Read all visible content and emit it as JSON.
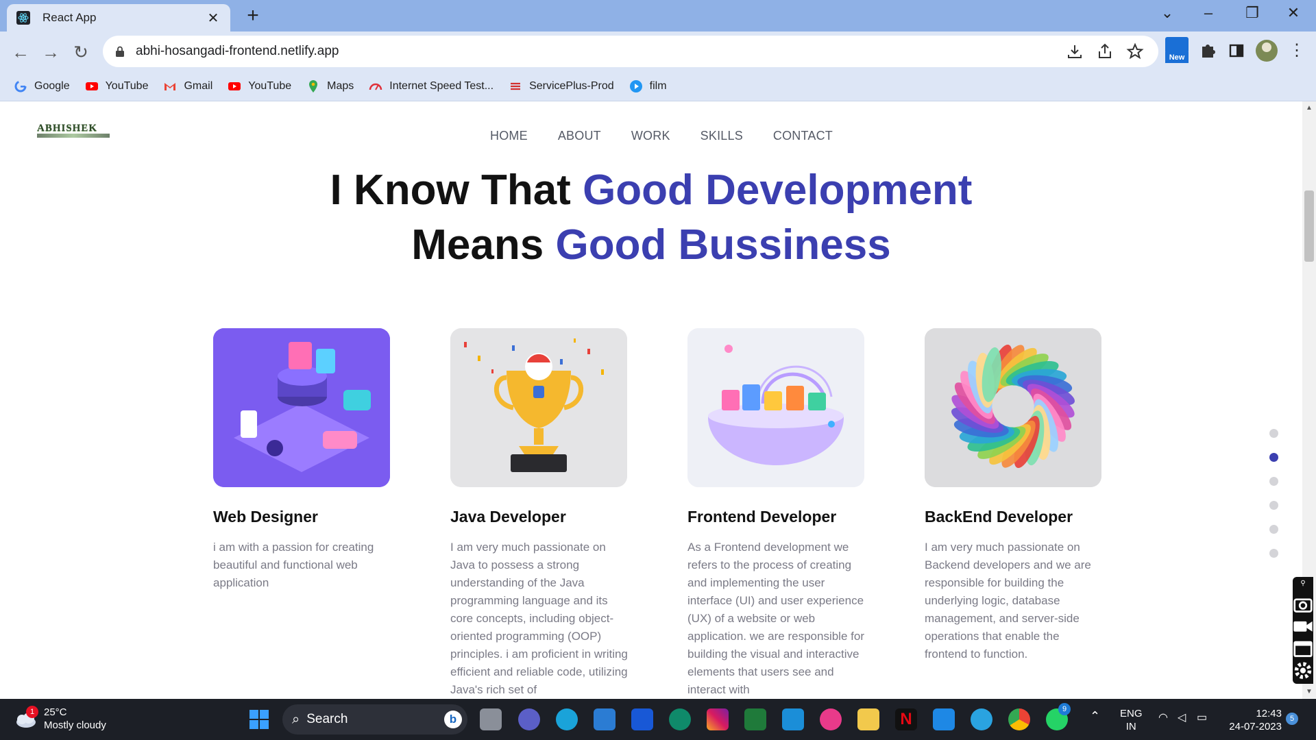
{
  "browser": {
    "tab_title": "React App",
    "url": "abhi-hosangadi-frontend.netlify.app",
    "new_badge": "New",
    "bookmarks": [
      {
        "label": "Google",
        "icon": "google-icon"
      },
      {
        "label": "YouTube",
        "icon": "youtube-icon"
      },
      {
        "label": "Gmail",
        "icon": "gmail-icon"
      },
      {
        "label": "YouTube",
        "icon": "youtube-icon"
      },
      {
        "label": "Maps",
        "icon": "maps-icon"
      },
      {
        "label": "Internet Speed Test...",
        "icon": "speedtest-icon"
      },
      {
        "label": "ServicePlus-Prod",
        "icon": "serviceplus-icon"
      },
      {
        "label": "film",
        "icon": "film-icon"
      }
    ]
  },
  "site": {
    "logo_text": "ABHISHEK",
    "nav": [
      "HOME",
      "ABOUT",
      "WORK",
      "SKILLS",
      "CONTACT"
    ],
    "hero": {
      "line1_plain": "I Know That ",
      "line1_accent": "Good Development",
      "line2_plain": "Means ",
      "line2_accent": "Good Bussiness"
    },
    "cards": [
      {
        "title": "Web Designer",
        "text": "i am with a passion for creating beautiful and functional web application"
      },
      {
        "title": "Java Developer",
        "text": "I am very much passionate on Java to possess a strong understanding of the Java programming language and its core concepts, including object-oriented programming (OOP) principles. i am proficient in writing efficient and reliable code, utilizing Java's rich set of"
      },
      {
        "title": "Frontend Developer",
        "text": "As a Frontend development we refers to the process of creating and implementing the user interface (UI) and user experience (UX) of a website or web application. we are responsible for building the visual and interactive elements that users see and interact with"
      },
      {
        "title": "BackEnd Developer",
        "text": "I am very much passionate on Backend developers and we are responsible for building the underlying logic, database management, and server-side operations that enable the frontend to function."
      }
    ],
    "accent_color": "#3b3fb0",
    "active_section_dot": 2
  },
  "taskbar": {
    "weather_temp": "25°C",
    "weather_desc": "Mostly cloudy",
    "weather_badge": "1",
    "search_label": "Search",
    "whatsapp_badge": "9",
    "lang_line1": "ENG",
    "lang_line2": "IN",
    "time": "12:43",
    "date": "24-07-2023",
    "notif_count": "5"
  }
}
